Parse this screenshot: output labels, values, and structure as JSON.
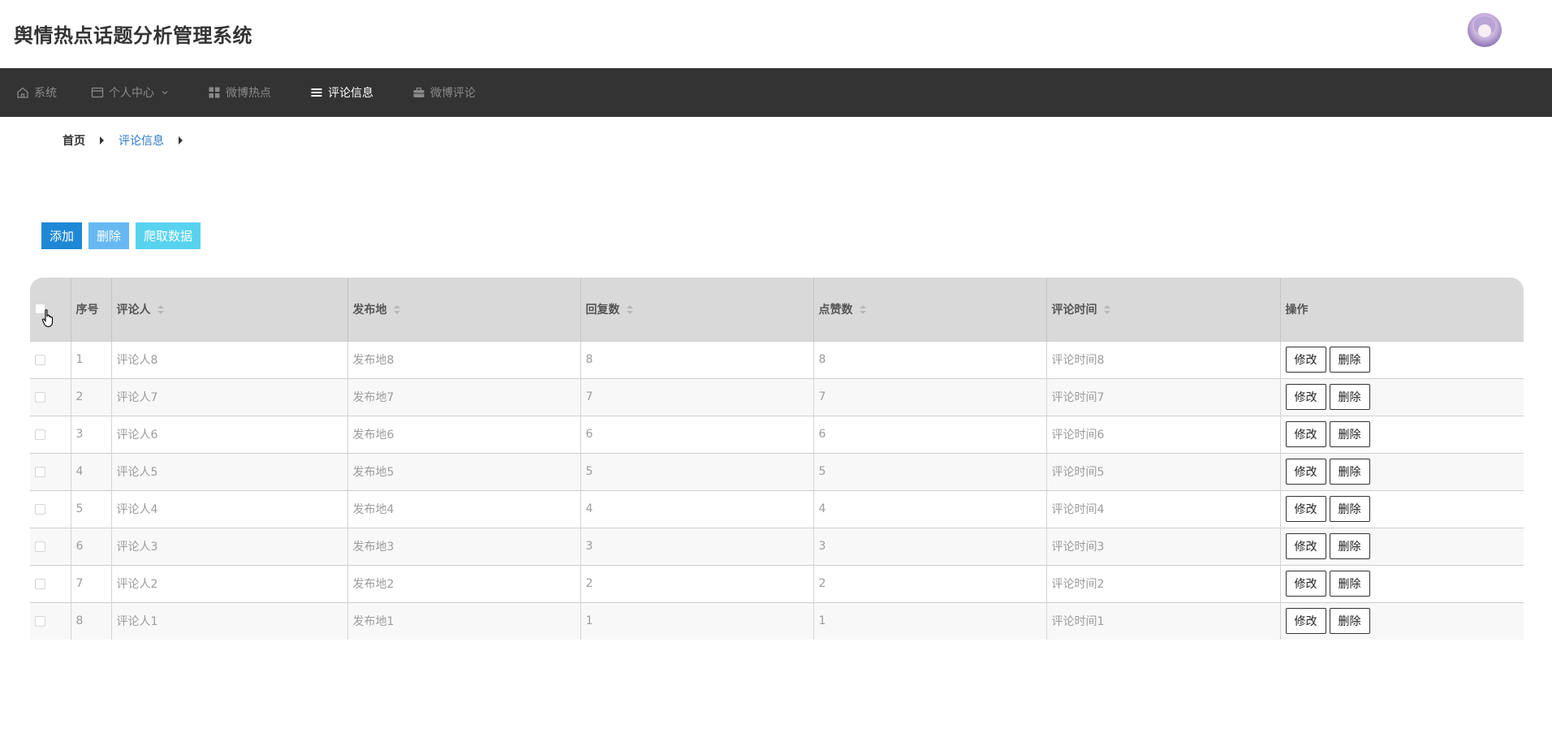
{
  "header": {
    "title": "舆情热点话题分析管理系统"
  },
  "nav": [
    {
      "label": "系统",
      "icon": "home-icon",
      "active": false
    },
    {
      "label": "个人中心",
      "icon": "card-icon",
      "active": false
    },
    {
      "label": "微博热点",
      "icon": "grid-icon",
      "active": false
    },
    {
      "label": "评论信息",
      "icon": "list-icon",
      "active": true
    },
    {
      "label": "微博评论",
      "icon": "briefcase-icon",
      "active": false
    }
  ],
  "breadcrumb": {
    "home": "首页",
    "current": "评论信息"
  },
  "actions": {
    "add": "添加",
    "delete": "删除",
    "crawl": "爬取数据"
  },
  "colors": {
    "nav_bg": "#333333",
    "header_bg": "#d9d9d9",
    "add": "#1e88d6",
    "delete": "#66b8f3",
    "crawl": "#58d3ef",
    "link": "#2d79c7"
  },
  "table": {
    "columns": [
      "序号",
      "评论人",
      "发布地",
      "回复数",
      "点赞数",
      "评论时间",
      "操作"
    ],
    "rows": [
      {
        "no": "1",
        "commenter": "评论人8",
        "location": "发布地8",
        "replies": "8",
        "likes": "8",
        "time": "评论时间8"
      },
      {
        "no": "2",
        "commenter": "评论人7",
        "location": "发布地7",
        "replies": "7",
        "likes": "7",
        "time": "评论时间7"
      },
      {
        "no": "3",
        "commenter": "评论人6",
        "location": "发布地6",
        "replies": "6",
        "likes": "6",
        "time": "评论时间6"
      },
      {
        "no": "4",
        "commenter": "评论人5",
        "location": "发布地5",
        "replies": "5",
        "likes": "5",
        "time": "评论时间5"
      },
      {
        "no": "5",
        "commenter": "评论人4",
        "location": "发布地4",
        "replies": "4",
        "likes": "4",
        "time": "评论时间4"
      },
      {
        "no": "6",
        "commenter": "评论人3",
        "location": "发布地3",
        "replies": "3",
        "likes": "3",
        "time": "评论时间3"
      },
      {
        "no": "7",
        "commenter": "评论人2",
        "location": "发布地2",
        "replies": "2",
        "likes": "2",
        "time": "评论时间2"
      },
      {
        "no": "8",
        "commenter": "评论人1",
        "location": "发布地1",
        "replies": "1",
        "likes": "1",
        "time": "评论时间1"
      }
    ],
    "row_actions": {
      "edit": "修改",
      "delete": "删除"
    }
  }
}
